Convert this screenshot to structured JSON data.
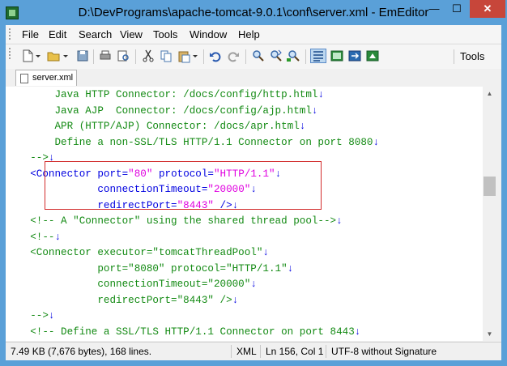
{
  "window": {
    "title": "D:\\DevPrograms\\apache-tomcat-9.0.1\\conf\\server.xml - EmEditor",
    "minimize": "—",
    "maximize": "☐",
    "close": "✕"
  },
  "menu": [
    "File",
    "Edit",
    "Search",
    "View",
    "Tools",
    "Window",
    "Help"
  ],
  "toolbar": {
    "tools_label": "Tools"
  },
  "tab": {
    "label": "server.xml"
  },
  "code_lines": [
    {
      "segments": [
        {
          "t": "        Java HTTP Connector: /docs/config/http.html",
          "c": "c-com"
        },
        {
          "t": "↓",
          "c": "c-eol"
        }
      ]
    },
    {
      "segments": [
        {
          "t": "        Java AJP  Connector: /docs/config/ajp.html",
          "c": "c-com"
        },
        {
          "t": "↓",
          "c": "c-eol"
        }
      ]
    },
    {
      "segments": [
        {
          "t": "        APR (HTTP/AJP) Connector: /docs/apr.html",
          "c": "c-com"
        },
        {
          "t": "↓",
          "c": "c-eol"
        }
      ]
    },
    {
      "segments": [
        {
          "t": "        Define a non-SSL/TLS HTTP/1.1 Connector on port 8080",
          "c": "c-com"
        },
        {
          "t": "↓",
          "c": "c-eol"
        }
      ]
    },
    {
      "segments": [
        {
          "t": "    -->",
          "c": "c-com"
        },
        {
          "t": "↓",
          "c": "c-eol"
        }
      ]
    },
    {
      "segments": [
        {
          "t": "    <Connector ",
          "c": "c-tag"
        },
        {
          "t": "port=",
          "c": "c-attr"
        },
        {
          "t": "\"80\"",
          "c": "c-val"
        },
        {
          "t": " protocol=",
          "c": "c-attr"
        },
        {
          "t": "\"HTTP/1.1\"",
          "c": "c-val"
        },
        {
          "t": "↓",
          "c": "c-eol"
        }
      ]
    },
    {
      "segments": [
        {
          "t": "               connectionTimeout=",
          "c": "c-attr"
        },
        {
          "t": "\"20000\"",
          "c": "c-val"
        },
        {
          "t": "↓",
          "c": "c-eol"
        }
      ]
    },
    {
      "segments": [
        {
          "t": "               redirectPort=",
          "c": "c-attr"
        },
        {
          "t": "\"8443\"",
          "c": "c-val"
        },
        {
          "t": " />",
          "c": "c-tag"
        },
        {
          "t": "↓",
          "c": "c-eol"
        }
      ]
    },
    {
      "segments": [
        {
          "t": "    <!-- A \"Connector\" using the shared thread pool-->",
          "c": "c-com"
        },
        {
          "t": "↓",
          "c": "c-eol"
        }
      ]
    },
    {
      "segments": [
        {
          "t": "    <!--",
          "c": "c-com"
        },
        {
          "t": "↓",
          "c": "c-eol"
        }
      ]
    },
    {
      "segments": [
        {
          "t": "    <Connector executor=\"tomcatThreadPool\"",
          "c": "c-com"
        },
        {
          "t": "↓",
          "c": "c-eol"
        }
      ]
    },
    {
      "segments": [
        {
          "t": "               port=\"8080\" protocol=\"HTTP/1.1\"",
          "c": "c-com"
        },
        {
          "t": "↓",
          "c": "c-eol"
        }
      ]
    },
    {
      "segments": [
        {
          "t": "               connectionTimeout=\"20000\"",
          "c": "c-com"
        },
        {
          "t": "↓",
          "c": "c-eol"
        }
      ]
    },
    {
      "segments": [
        {
          "t": "               redirectPort=\"8443\" />",
          "c": "c-com"
        },
        {
          "t": "↓",
          "c": "c-eol"
        }
      ]
    },
    {
      "segments": [
        {
          "t": "    -->",
          "c": "c-com"
        },
        {
          "t": "↓",
          "c": "c-eol"
        }
      ]
    },
    {
      "segments": [
        {
          "t": "    <!-- Define a SSL/TLS HTTP/1.1 Connector on port 8443",
          "c": "c-com"
        },
        {
          "t": "↓",
          "c": "c-eol"
        }
      ]
    }
  ],
  "status": {
    "info": "7.49 KB (7,676 bytes), 168 lines.",
    "mode": "XML",
    "position": "Ln 156, Col 1",
    "encoding": "UTF-8 without Signature"
  },
  "colors": {
    "comment": "#138a13",
    "tag": "#0000e0",
    "value": "#e000e0",
    "highlight_box": "#d22b2b",
    "title_bg": "#5aa0d8",
    "close_button": "#c7463a"
  },
  "icons": [
    "new-file-icon",
    "open-folder-icon",
    "save-icon",
    "print-icon",
    "print-preview-icon",
    "cut-icon",
    "copy-icon",
    "paste-icon",
    "undo-icon",
    "redo-icon",
    "find-icon",
    "find-next-icon",
    "replace-icon",
    "word-wrap-icon",
    "toggle-icon-1",
    "toggle-icon-2",
    "toggle-icon-3"
  ]
}
